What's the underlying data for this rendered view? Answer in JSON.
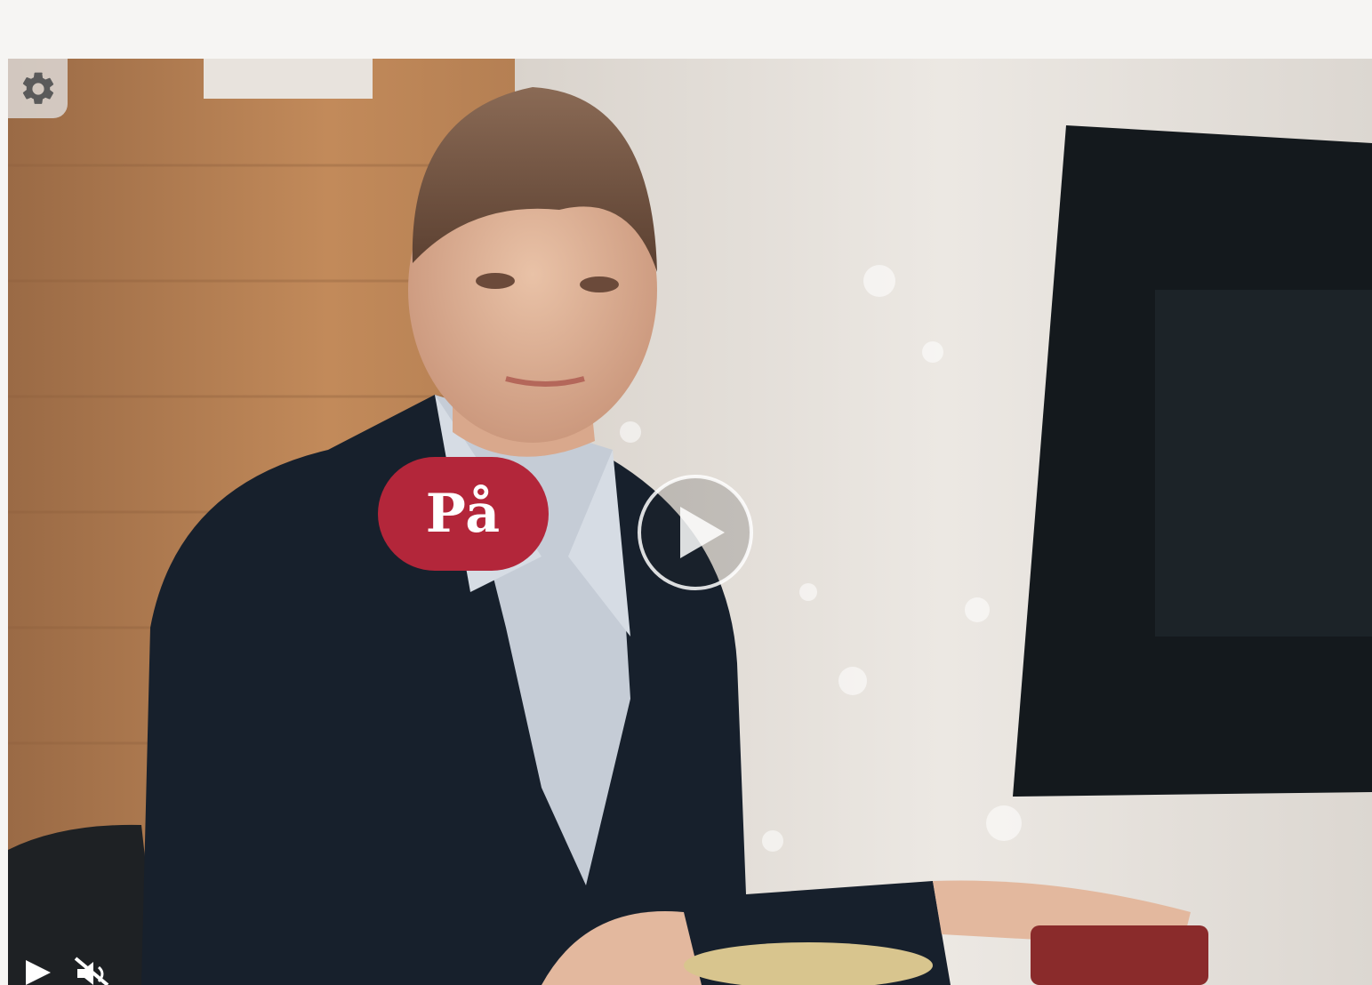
{
  "brand": {
    "badge_text": "På",
    "badge_color": "#b3263a"
  },
  "icons": {
    "settings": "gear-icon",
    "play_overlay": "play-circle-icon",
    "play": "play-icon",
    "mute": "volume-muted-icon"
  },
  "colors": {
    "page_background": "#f6f5f3",
    "overlay_button": "#e1e1e1",
    "icon_dark": "#5a5a5a",
    "icon_light": "#ffffff"
  }
}
